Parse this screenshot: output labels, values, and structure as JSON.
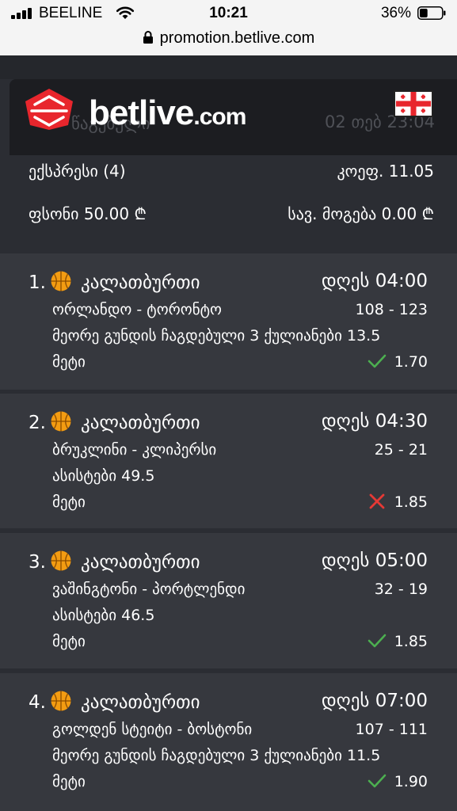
{
  "status_bar": {
    "carrier": "BEELINE",
    "time": "10:21",
    "battery": "36%",
    "battery_level": 0.36
  },
  "browser": {
    "url": "promotion.betlive.com"
  },
  "header": {
    "logo_text": "betlive",
    "logo_suffix": ".com",
    "faded_label": "წაგებული",
    "faded_date": "02 თებ 23:04",
    "flag": "georgia-flag-icon"
  },
  "summary": {
    "bet_type": "ექსპრესი (4)",
    "odds": "კოეფ. 11.05",
    "stake": "ფსონი 50.00 ₾",
    "payout": "სავ. მოგება 0.00 ₾"
  },
  "bets": [
    {
      "index": "1.",
      "sport": "კალათბურთი",
      "sport_icon": "basketball-icon",
      "time": "დღეს 04:00",
      "teams": "ორლანდო - ტორონტო",
      "score": "108 - 123",
      "market": "მეორე გუნდის ჩაგდებული 3 ქულიანები 13.5",
      "pick": "მეტი",
      "result": "won",
      "result_icon": "check-icon",
      "odds": "1.70"
    },
    {
      "index": "2.",
      "sport": "კალათბურთი",
      "sport_icon": "basketball-icon",
      "time": "დღეს 04:30",
      "teams": "ბრუკლინი - კლიპერსი",
      "score": "25 - 21",
      "market": "ასისტები 49.5",
      "pick": "მეტი",
      "result": "lost",
      "result_icon": "cross-icon",
      "odds": "1.85"
    },
    {
      "index": "3.",
      "sport": "კალათბურთი",
      "sport_icon": "basketball-icon",
      "time": "დღეს 05:00",
      "teams": "ვაშინგტონი - პორტლენდი",
      "score": "32 - 19",
      "market": "ასისტები 46.5",
      "pick": "მეტი",
      "result": "won",
      "result_icon": "check-icon",
      "odds": "1.85"
    },
    {
      "index": "4.",
      "sport": "კალათბურთი",
      "sport_icon": "basketball-icon",
      "time": "დღეს 07:00",
      "teams": "გოლდენ სტეიტი - ბოსტონი",
      "score": "107 - 111",
      "market": "მეორე გუნდის ჩაგდებული 3 ქულიანები 11.5",
      "pick": "მეტი",
      "result": "won",
      "result_icon": "check-icon",
      "odds": "1.90"
    }
  ],
  "colors": {
    "background": "#2b2d33",
    "card": "#36383e",
    "win": "#4caf50",
    "loss": "#e53935",
    "basketball": "#f39c12",
    "brand_red": "#e8262d"
  }
}
